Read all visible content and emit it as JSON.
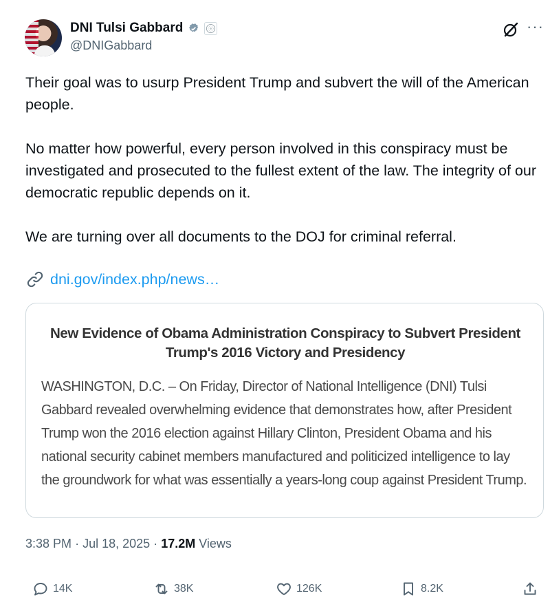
{
  "author": {
    "display_name": "DNI Tulsi Gabbard",
    "handle": "@DNIGabbard",
    "verified_icon": "verified-badge-icon",
    "affiliation_icon": "odni-seal-icon"
  },
  "tweet": {
    "paragraphs": [
      "Their goal was to usurp President Trump and subvert the will of the American people.",
      "No matter how powerful, every person involved in this conspiracy must be investigated and prosecuted to the fullest extent of the law. The integrity of our democratic republic depends on it.",
      "We are turning over all documents to the DOJ for criminal referral."
    ],
    "link_text": "dni.gov/index.php/news…"
  },
  "card": {
    "title": "New Evidence of Obama Administration Conspiracy to Subvert President Trump's 2016 Victory and Presidency",
    "body": "WASHINGTON, D.C. – On Friday, Director of National Intelligence (DNI) Tulsi Gabbard revealed overwhelming evidence that demonstrates how, after President Trump won the 2016 election against Hillary Clinton, President Obama and his national security cabinet members manufactured and politicized intelligence to lay the groundwork for what was essentially a years-long coup against President Trump."
  },
  "meta": {
    "time": "3:38 PM",
    "separator": "·",
    "date": "Jul 18, 2025",
    "views_count": "17.2M",
    "views_label": "Views"
  },
  "actions": {
    "replies": "14K",
    "reposts": "38K",
    "likes": "126K",
    "bookmarks": "8.2K"
  },
  "colors": {
    "link": "#1d9bf0",
    "verified": "#829aab",
    "secondary_text": "#536471",
    "border": "#cfd9de"
  }
}
